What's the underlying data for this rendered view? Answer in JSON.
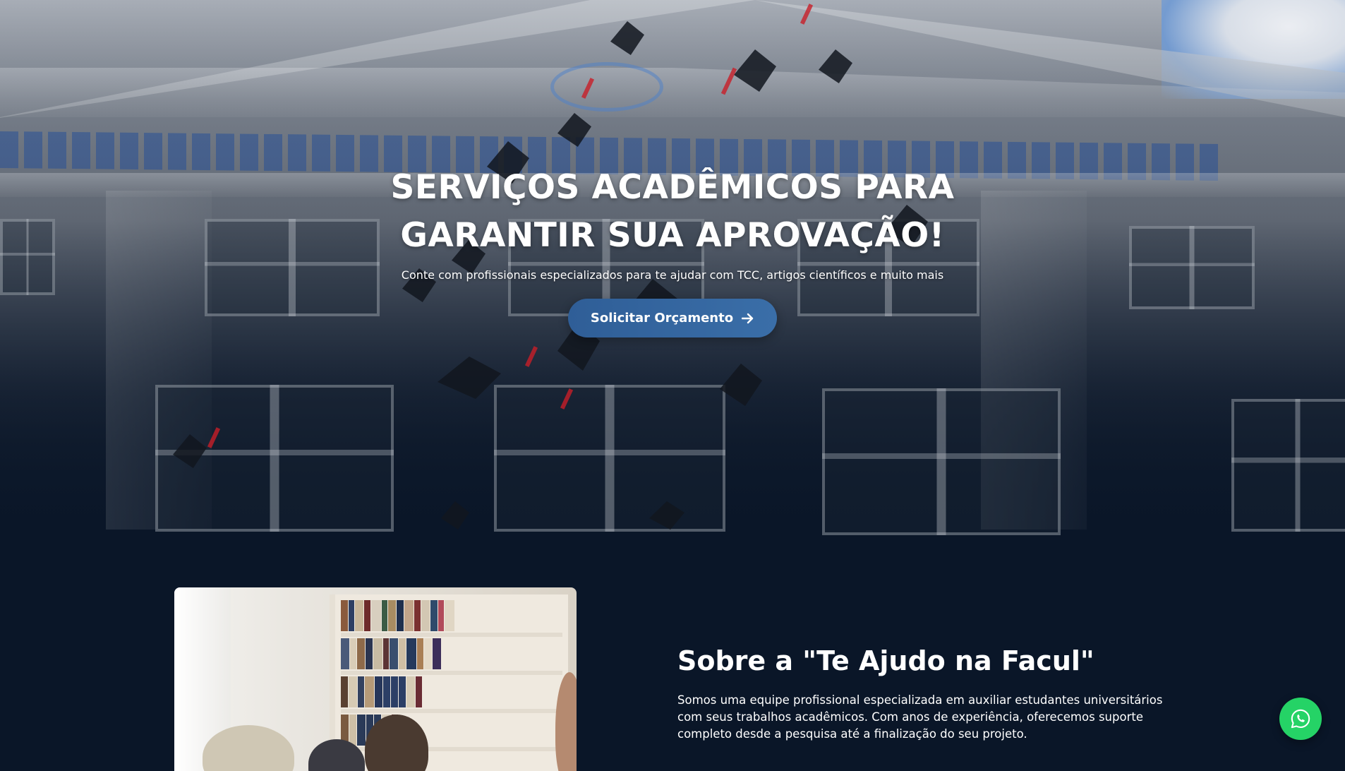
{
  "hero": {
    "title_line1": "SERVIÇOS ACADÊMICOS PARA",
    "title_line2": "GARANTIR SUA APROVAÇÃO!",
    "subtitle": "Conte com profissionais especializados para te ajudar com TCC, artigos científicos e muito mais",
    "cta_label": "Solicitar Orçamento",
    "cta_icon": "arrow-right-icon",
    "button_color": "#2f5e97"
  },
  "about": {
    "title": "Sobre a \"Te Ajudo na Facul\"",
    "paragraph": "Somos uma equipe profissional especializada em auxiliar estudantes universitários com seus trabalhos acadêmicos. Com anos de experiência, oferecemos suporte completo desde a pesquisa até a finalização do seu projeto."
  },
  "floating": {
    "whatsapp_icon": "whatsapp-icon",
    "whatsapp_color": "#25d366"
  },
  "theme": {
    "background": "#0a1628",
    "text": "#ffffff"
  }
}
